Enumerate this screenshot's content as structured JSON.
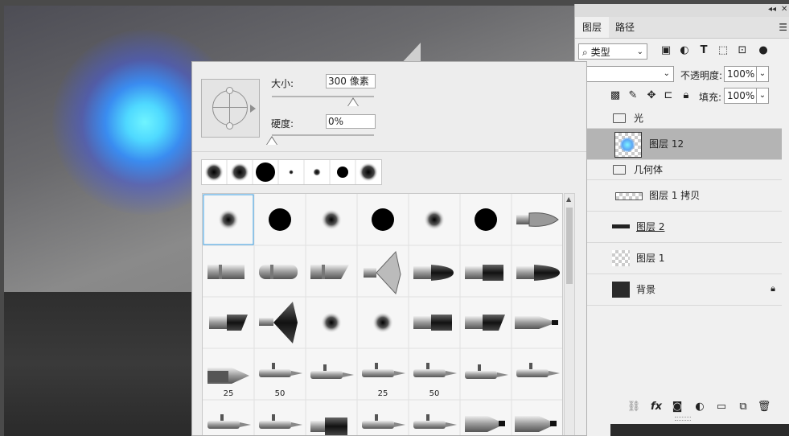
{
  "window": {
    "collapse_label": "◂◂",
    "close_label": "✕"
  },
  "layers_panel": {
    "tabs": [
      {
        "label": "图层",
        "active": true
      },
      {
        "label": "路径",
        "active": false
      }
    ],
    "filter": {
      "label": "类型"
    },
    "opacity": {
      "label": "不透明度:",
      "value": "100%"
    },
    "fill": {
      "label": "填充:",
      "value": "100%"
    },
    "layers": [
      {
        "name": "光",
        "kind": "group"
      },
      {
        "name": "图层 12",
        "kind": "layer",
        "selected": true
      },
      {
        "name": "几何体",
        "kind": "group"
      },
      {
        "name": "图层 1 拷贝",
        "kind": "layer"
      },
      {
        "name": "图层 2",
        "kind": "layer"
      },
      {
        "name": "图层 1",
        "kind": "layer"
      },
      {
        "name": "背景",
        "kind": "background",
        "locked": true
      }
    ],
    "bottom_icons": [
      "link-icon",
      "fx-icon",
      "mask-icon",
      "adjustment-icon",
      "folder-icon",
      "new-layer-icon",
      "trash-icon"
    ],
    "fx_label": "fx"
  },
  "brush_picker": {
    "size": {
      "label": "大小:",
      "value": "300 像素"
    },
    "hardness": {
      "label": "硬度:",
      "value": "0%"
    },
    "size_labels": [
      "25",
      "50",
      "25",
      "50"
    ]
  },
  "colors": {
    "accent": "#3aa0e6",
    "glow": "#5ef0ff"
  }
}
